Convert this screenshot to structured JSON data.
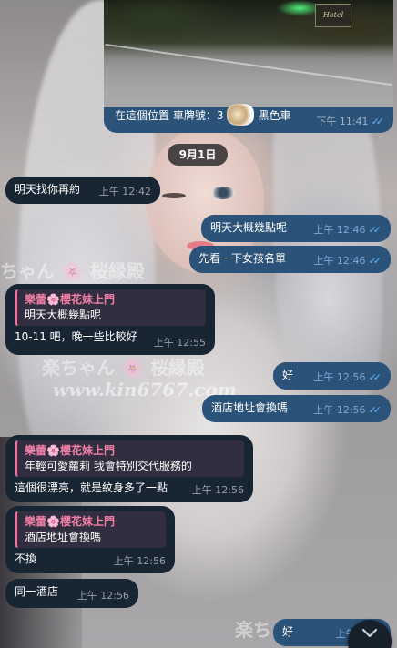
{
  "photo_message": {
    "caption_before": "在這個位置 車牌號：3",
    "caption_after": "黑色車",
    "time": "下午 11:41",
    "sign_text": "Hotel"
  },
  "date_separator": "9月1日",
  "messages": [
    {
      "text": "明天找你再約",
      "time": "上午 12:42"
    },
    {
      "text": "明天大概幾點呢",
      "time": "上午 12:46"
    },
    {
      "text": "先看一下女孩名單",
      "time": "上午 12:46"
    },
    {
      "reply_name": "樂蕾🌸櫻花妹上門",
      "reply_text": "明天大概幾點呢",
      "text": "10-11 吧，晚一些比較好",
      "time": "上午 12:55"
    },
    {
      "text": "好",
      "time": "上午 12:56"
    },
    {
      "text": "酒店地址會換嗎",
      "time": "上午 12:56"
    },
    {
      "reply_name": "樂蕾🌸櫻花妹上門",
      "reply_text": "年輕可愛蘿莉 我會特別交代服務的",
      "text": "這個很漂亮，就是紋身多了一點",
      "time": "上午 12:56"
    },
    {
      "reply_name": "樂蕾🌸櫻花妹上門",
      "reply_text": "酒店地址會換嗎",
      "text": "不換",
      "time": "上午 12:56"
    },
    {
      "text": "同一酒店",
      "time": "上午 12:56"
    },
    {
      "text": "好",
      "time": "上午 12:5"
    }
  ],
  "watermarks": [
    "ちゃん 🌸 桜縁殿",
    "楽ちゃん 🌸 桜縁殿",
    "www.kin6767.com",
    "6767",
    "楽ち"
  ],
  "colors": {
    "incoming_bubble": "#182533",
    "outgoing_bubble": "#2b5278",
    "reply_accent": "#f2709c",
    "read_ticks": "#6ab2f2"
  },
  "icons": {
    "read_ticks": "double-check-icon",
    "scroll_down": "chevron-down-icon"
  }
}
